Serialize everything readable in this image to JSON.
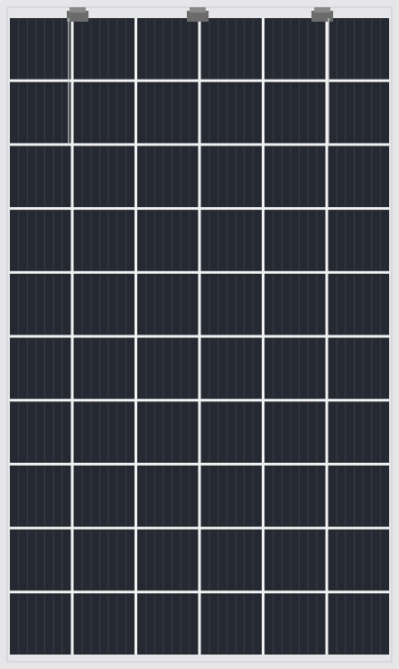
{
  "image": {
    "subject": "solar-panel",
    "grid": {
      "columns": 6,
      "rows": 10
    },
    "colors": {
      "frame": "#e6e6e8",
      "frame_edge": "#c9c9cc",
      "cell": "#252932",
      "cell_line": "#3a3f4a",
      "grid_gap": "#f2f2f2",
      "junction_box": "#6b6b6b",
      "ribbon": "#cfcfcf"
    },
    "junction_boxes": 3
  }
}
